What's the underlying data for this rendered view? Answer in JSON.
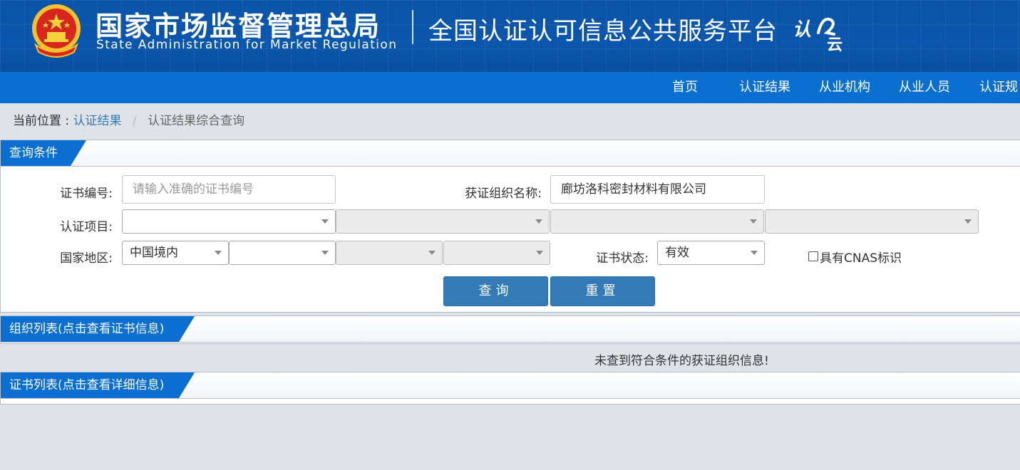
{
  "header": {
    "org_cn": "国家市场监督管理总局",
    "org_en": "State Administration  for  Market Regulation",
    "platform": "全国认证认可信息公共服务平台",
    "logo_text": "认云"
  },
  "nav": {
    "items": [
      "首页",
      "认证结果",
      "从业机构",
      "从业人员",
      "认证规"
    ]
  },
  "breadcrumb": {
    "label": "当前位置 :",
    "link": "认证结果",
    "separator": "/",
    "current": "认证结果综合查询"
  },
  "query_panel": {
    "title": "查询条件",
    "cert_no_label": "证书编号:",
    "cert_no_placeholder": "请输入准确的证书编号",
    "org_name_label": "获证组织名称:",
    "org_name_value": "廊坊洛科密封材料有限公司",
    "project_label": "认证项目:",
    "project_selects": [
      "",
      "",
      "",
      ""
    ],
    "region_label": "国家地区:",
    "region_selects": [
      "中国境内",
      "",
      "",
      ""
    ],
    "status_label": "证书状态:",
    "status_value": "有效",
    "cnas_label": "具有CNAS标识",
    "search_button": "查询",
    "reset_button": "重置"
  },
  "org_panel": {
    "title": "组织列表(点击查看证书信息)",
    "empty_message": "未查到符合条件的获证组织信息!"
  },
  "cert_panel": {
    "title": "证书列表(点击查看详细信息)"
  },
  "colors": {
    "header_blue": "#0b57ad",
    "nav_blue": "#0a6fd0",
    "button_blue": "#337ab7",
    "page_bg": "#dfe3e8"
  }
}
